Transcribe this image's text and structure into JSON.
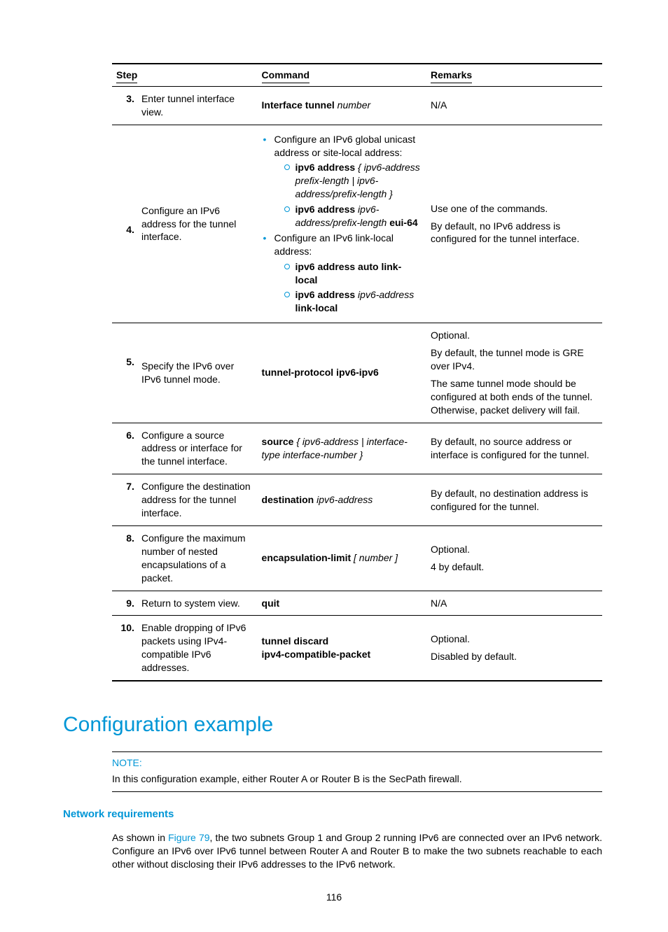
{
  "table": {
    "headers": {
      "step": "Step",
      "command": "Command",
      "remarks": "Remarks"
    },
    "rows": {
      "r3": {
        "num": "3.",
        "step": "Enter tunnel interface view.",
        "cmd_b": "Interface tunnel",
        "cmd_i": " number",
        "remarks": "N/A"
      },
      "r4": {
        "num": "4.",
        "step": "Configure an IPv6 address for the tunnel interface.",
        "b1_intro": "Configure an IPv6 global unicast address or site-local address:",
        "b1_o1_b": "ipv6 address",
        "b1_o1_rest": " { ipv6-address prefix-length | ipv6-address/prefix-length }",
        "b1_o2_b1": "ipv6 address",
        "b1_o2_mid": " ipv6-address/prefix-length ",
        "b1_o2_b2": "eui-64",
        "b2_intro": "Configure an IPv6 link-local address:",
        "b2_o1": "ipv6 address auto link-local",
        "b2_o2_b": "ipv6 address",
        "b2_o2_i": " ipv6-address ",
        "b2_o2_b2": "link-local",
        "rem1": "Use one of the commands.",
        "rem2": "By default, no IPv6 address is configured for the tunnel interface."
      },
      "r5": {
        "num": "5.",
        "step": "Specify the IPv6 over IPv6 tunnel mode.",
        "cmd": "tunnel-protocol ipv6-ipv6",
        "rem1": "Optional.",
        "rem2": "By default, the tunnel mode is GRE over IPv4.",
        "rem3": "The same tunnel mode should be configured at both ends of the tunnel. Otherwise, packet delivery will fail."
      },
      "r6": {
        "num": "6.",
        "step": "Configure a source address or interface for the tunnel interface.",
        "cmd_b": "source",
        "cmd_rest": " { ipv6-address | interface-type interface-number }",
        "remarks": "By default, no source address or interface is configured for the tunnel."
      },
      "r7": {
        "num": "7.",
        "step": "Configure the destination address for the tunnel interface.",
        "cmd_b": "destination",
        "cmd_i": " ipv6-address",
        "remarks": "By default, no destination address is configured for the tunnel."
      },
      "r8": {
        "num": "8.",
        "step": "Configure the maximum number of nested encapsulations of a packet.",
        "cmd_b": "encapsulation-limit",
        "cmd_rest": " [ number ]",
        "rem1": "Optional.",
        "rem2": "4 by default."
      },
      "r9": {
        "num": "9.",
        "step": "Return to system view.",
        "cmd": "quit",
        "remarks": "N/A"
      },
      "r10": {
        "num": "10.",
        "step": "Enable dropping of IPv6 packets using IPv4-compatible IPv6 addresses.",
        "cmd_l1": "tunnel discard",
        "cmd_l2": "ipv4-compatible-packet",
        "rem1": "Optional.",
        "rem2": "Disabled by default."
      }
    }
  },
  "section_heading": "Configuration example",
  "note": {
    "label": "NOTE:",
    "text": "In this configuration example, either Router A or Router B is the SecPath firewall."
  },
  "subheading": "Network requirements",
  "body": {
    "prefix": "As shown in ",
    "link": "Figure 79",
    "rest": ", the two subnets Group 1 and Group 2 running IPv6 are connected over an IPv6 network. Configure an IPv6 over IPv6 tunnel between Router A and Router B to make the two subnets reachable to each other without disclosing their IPv6 addresses to the IPv6 network."
  },
  "page_number": "116"
}
